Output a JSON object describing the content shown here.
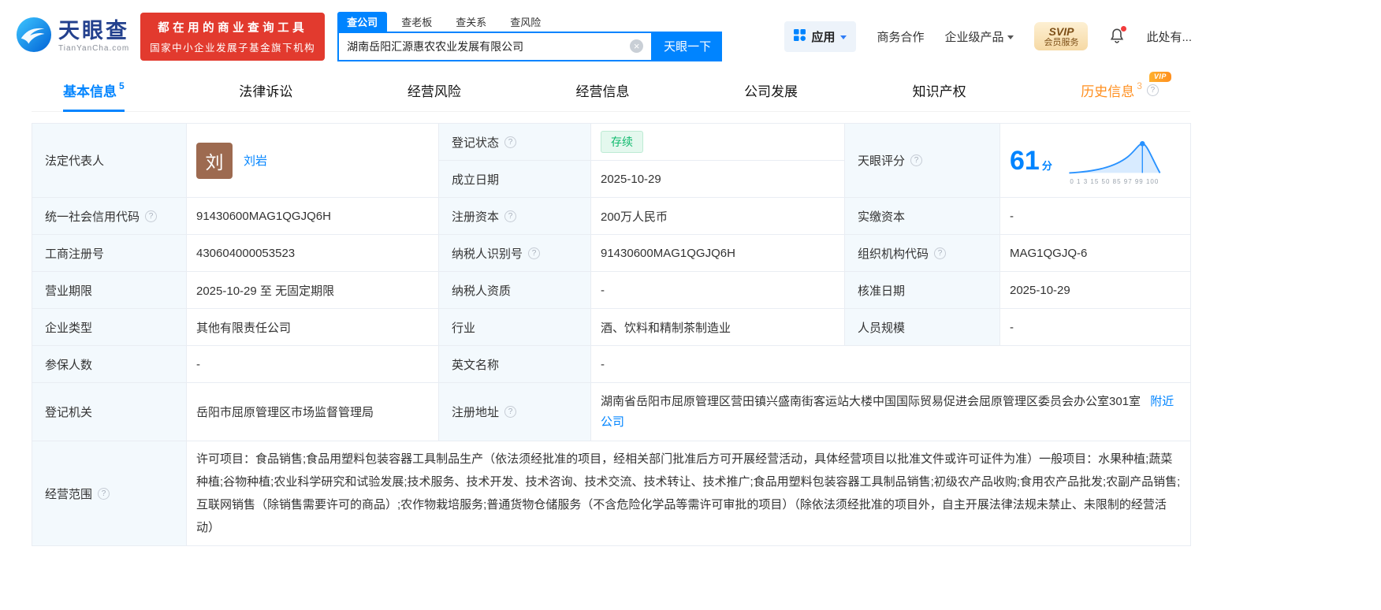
{
  "header": {
    "logo": {
      "title": "天眼查",
      "subtitle": "TianYanCha.com"
    },
    "promo": {
      "line1": "都在用的商业查询工具",
      "line2": "国家中小企业发展子基金旗下机构"
    },
    "search_tabs": [
      {
        "label": "查公司"
      },
      {
        "label": "查老板"
      },
      {
        "label": "查关系"
      },
      {
        "label": "查风险"
      }
    ],
    "search": {
      "value": "湖南岳阳汇源惠农农业发展有限公司",
      "button": "天眼一下"
    },
    "nav": {
      "apps": "应用",
      "cooperation": "商务合作",
      "enterprise": "企业级产品",
      "vip_top": "SVIP",
      "vip_bottom": "会员服务",
      "account": "此处有..."
    }
  },
  "tabs": {
    "basic": {
      "label": "基本信息",
      "count": "5"
    },
    "legal": {
      "label": "法律诉讼"
    },
    "risk": {
      "label": "经营风险"
    },
    "operation": {
      "label": "经营信息"
    },
    "development": {
      "label": "公司发展"
    },
    "ip": {
      "label": "知识产权"
    },
    "history": {
      "label": "历史信息",
      "count": "3",
      "vip": "VIP"
    }
  },
  "basic_info": {
    "legal_rep": {
      "label": "法定代表人",
      "avatar": "刘",
      "name": "刘岩"
    },
    "reg_status": {
      "label": "登记状态",
      "value": "存续"
    },
    "establish_date": {
      "label": "成立日期",
      "value": "2025-10-29"
    },
    "score": {
      "label": "天眼评分",
      "value": "61",
      "unit": "分",
      "axis": "0 1 3 15 50 85 97 99 100"
    },
    "credit_code": {
      "label": "统一社会信用代码",
      "value": "91430600MAG1QGJQ6H"
    },
    "reg_capital": {
      "label": "注册资本",
      "value": "200万人民币"
    },
    "paid_capital": {
      "label": "实缴资本",
      "value": "-"
    },
    "reg_no": {
      "label": "工商注册号",
      "value": "430604000053523"
    },
    "taxpayer_id": {
      "label": "纳税人识别号",
      "value": "91430600MAG1QGJQ6H"
    },
    "org_code": {
      "label": "组织机构代码",
      "value": "MAG1QGJQ-6"
    },
    "business_term": {
      "label": "营业期限",
      "value": "2025-10-29 至 无固定期限"
    },
    "taxpayer_qualification": {
      "label": "纳税人资质",
      "value": "-"
    },
    "approved_date": {
      "label": "核准日期",
      "value": "2025-10-29"
    },
    "company_type": {
      "label": "企业类型",
      "value": "其他有限责任公司"
    },
    "industry": {
      "label": "行业",
      "value": "酒、饮料和精制茶制造业"
    },
    "staff_size": {
      "label": "人员规模",
      "value": "-"
    },
    "insured_count": {
      "label": "参保人数",
      "value": "-"
    },
    "english_name": {
      "label": "英文名称",
      "value": "-"
    },
    "reg_authority": {
      "label": "登记机关",
      "value": "岳阳市屈原管理区市场监督管理局"
    },
    "address": {
      "label": "注册地址",
      "value": "湖南省岳阳市屈原管理区营田镇兴盛南街客运站大楼中国国际贸易促进会屈原管理区委员会办公室301室",
      "link": "附近公司"
    },
    "business_scope": {
      "label": "经营范围",
      "value": "许可项目：食品销售;食品用塑料包装容器工具制品生产（依法须经批准的项目，经相关部门批准后方可开展经营活动，具体经营项目以批准文件或许可证件为准）一般项目：水果种植;蔬菜种植;谷物种植;农业科学研究和试验发展;技术服务、技术开发、技术咨询、技术交流、技术转让、技术推广;食品用塑料包装容器工具制品销售;初级农产品收购;食用农产品批发;农副产品销售;互联网销售（除销售需要许可的商品）;农作物栽培服务;普通货物仓储服务（不含危险化学品等需许可审批的项目）（除依法须经批准的项目外，自主开展法律法规未禁止、未限制的经营活动）"
    }
  }
}
